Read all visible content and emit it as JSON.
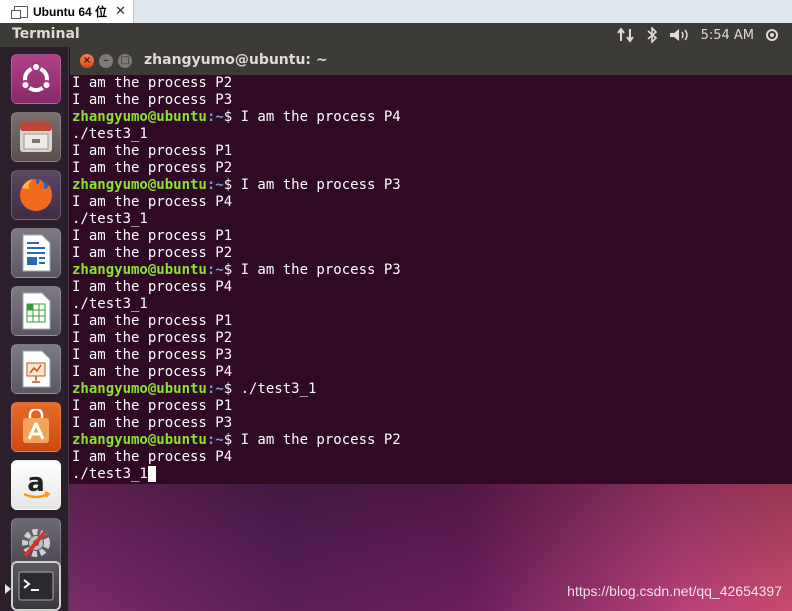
{
  "vm_tab": {
    "label": "Ubuntu 64 位",
    "close": "✕"
  },
  "topbar": {
    "app_title": "Terminal",
    "clock": "5:54 AM"
  },
  "launcher": {
    "items": [
      {
        "name": "ubuntu-dash-icon"
      },
      {
        "name": "files-icon"
      },
      {
        "name": "firefox-icon"
      },
      {
        "name": "libreoffice-writer-icon"
      },
      {
        "name": "libreoffice-calc-icon"
      },
      {
        "name": "libreoffice-impress-icon"
      },
      {
        "name": "software-center-icon"
      },
      {
        "name": "amazon-icon"
      },
      {
        "name": "system-settings-icon"
      },
      {
        "name": "terminal-icon"
      }
    ]
  },
  "terminal": {
    "title": "zhangyumo@ubuntu: ~",
    "lines": [
      {
        "text": "I am the process P2"
      },
      {
        "text": "I am the process P3"
      },
      {
        "user": "zhangyumo@ubuntu",
        "path": ":~",
        "text": "$ I am the process P4"
      },
      {
        "text": "./test3_1"
      },
      {
        "text": "I am the process P1"
      },
      {
        "text": "I am the process P2"
      },
      {
        "user": "zhangyumo@ubuntu",
        "path": ":~",
        "text": "$ I am the process P3"
      },
      {
        "text": "I am the process P4"
      },
      {
        "text": "./test3_1"
      },
      {
        "text": "I am the process P1"
      },
      {
        "text": "I am the process P2"
      },
      {
        "user": "zhangyumo@ubuntu",
        "path": ":~",
        "text": "$ I am the process P3"
      },
      {
        "text": "I am the process P4"
      },
      {
        "text": "./test3_1"
      },
      {
        "text": "I am the process P1"
      },
      {
        "text": "I am the process P2"
      },
      {
        "text": "I am the process P3"
      },
      {
        "text": "I am the process P4"
      },
      {
        "user": "zhangyumo@ubuntu",
        "path": ":~",
        "text": "$ ./test3_1"
      },
      {
        "text": "I am the process P1"
      },
      {
        "text": "I am the process P3"
      },
      {
        "user": "zhangyumo@ubuntu",
        "path": ":~",
        "text": "$ I am the process P2"
      },
      {
        "text": "I am the process P4"
      },
      {
        "text": "./test3_1",
        "cursor": true
      }
    ]
  },
  "watermark": "https://blog.csdn.net/qq_42654397"
}
